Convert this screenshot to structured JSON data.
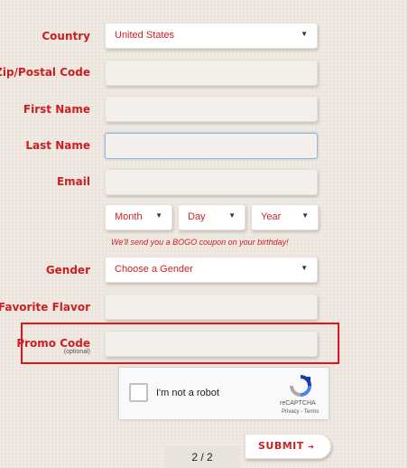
{
  "form": {
    "country": {
      "label": "Country",
      "value": "United States"
    },
    "zip": {
      "label": "Zip/Postal Code",
      "value": ""
    },
    "first_name": {
      "label": "First Name",
      "value": ""
    },
    "last_name": {
      "label": "Last Name",
      "value": ""
    },
    "email": {
      "label": "Email",
      "value": ""
    },
    "birthday": {
      "month": "Month",
      "day": "Day",
      "year": "Year",
      "note": "We'll send you a BOGO coupon on your birthday!"
    },
    "gender": {
      "label": "Gender",
      "value": "Choose a Gender"
    },
    "flavor": {
      "label": "Favorite Flavor",
      "value": ""
    },
    "promo": {
      "label": "Promo Code",
      "optional": "(optional)",
      "value": ""
    }
  },
  "captcha": {
    "text": "I'm not a robot",
    "brand": "reCAPTCHA",
    "terms": "Privacy - Terms"
  },
  "pager": {
    "text": "2 / 2"
  },
  "submit": {
    "label": "SUBMIT",
    "arrow": "➔"
  },
  "icons": {
    "dropdown": "chevron-down-icon",
    "captcha_logo": "recaptcha-icon"
  },
  "colors": {
    "accent": "#cc1f23",
    "highlight": "#e0151b"
  }
}
